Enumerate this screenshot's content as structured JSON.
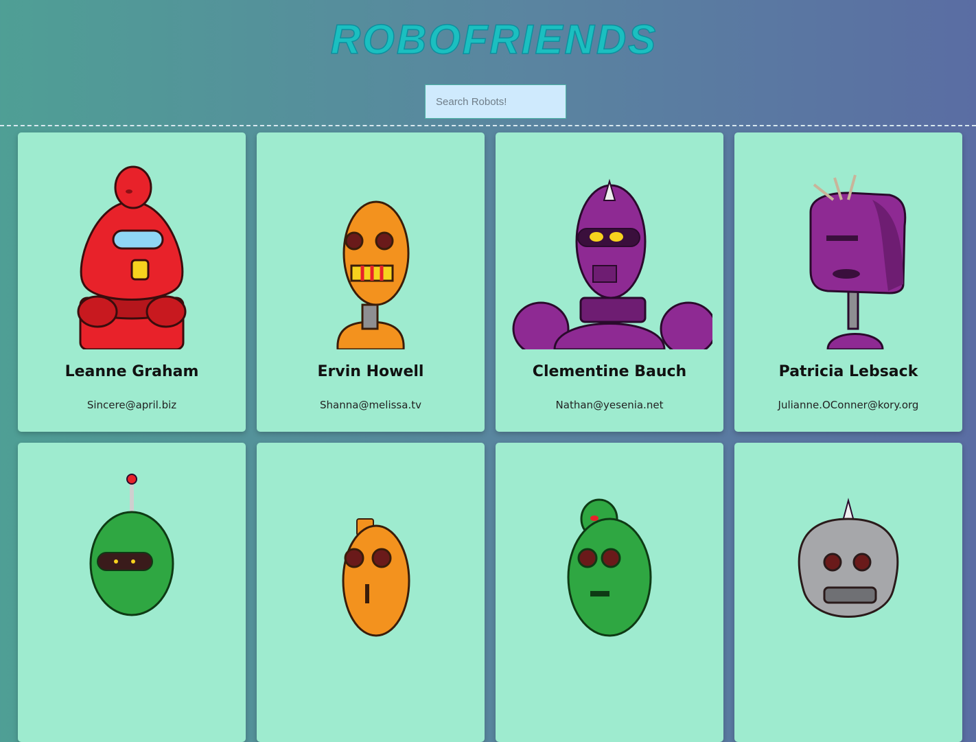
{
  "app": {
    "title": "ROBOFRIENDS"
  },
  "search": {
    "placeholder": "Search Robots!",
    "value": ""
  },
  "robots": [
    {
      "name": "Leanne Graham",
      "email": "Sincere@april.biz",
      "color": "#e8222a"
    },
    {
      "name": "Ervin Howell",
      "email": "Shanna@melissa.tv",
      "color": "#f3921e"
    },
    {
      "name": "Clementine Bauch",
      "email": "Nathan@yesenia.net",
      "color": "#8e2a93"
    },
    {
      "name": "Patricia Lebsack",
      "email": "Julianne.OConner@kory.org",
      "color": "#8e2a93"
    },
    {
      "name": "",
      "email": "",
      "color": "#2fa742"
    },
    {
      "name": "",
      "email": "",
      "color": "#f3921e"
    },
    {
      "name": "",
      "email": "",
      "color": "#2fa742"
    },
    {
      "name": "",
      "email": "",
      "color": "#a6a7aa"
    }
  ],
  "colors": {
    "accent": "#1bbfc0",
    "card": "#9eebcf",
    "search_bg": "#cfeafd"
  }
}
